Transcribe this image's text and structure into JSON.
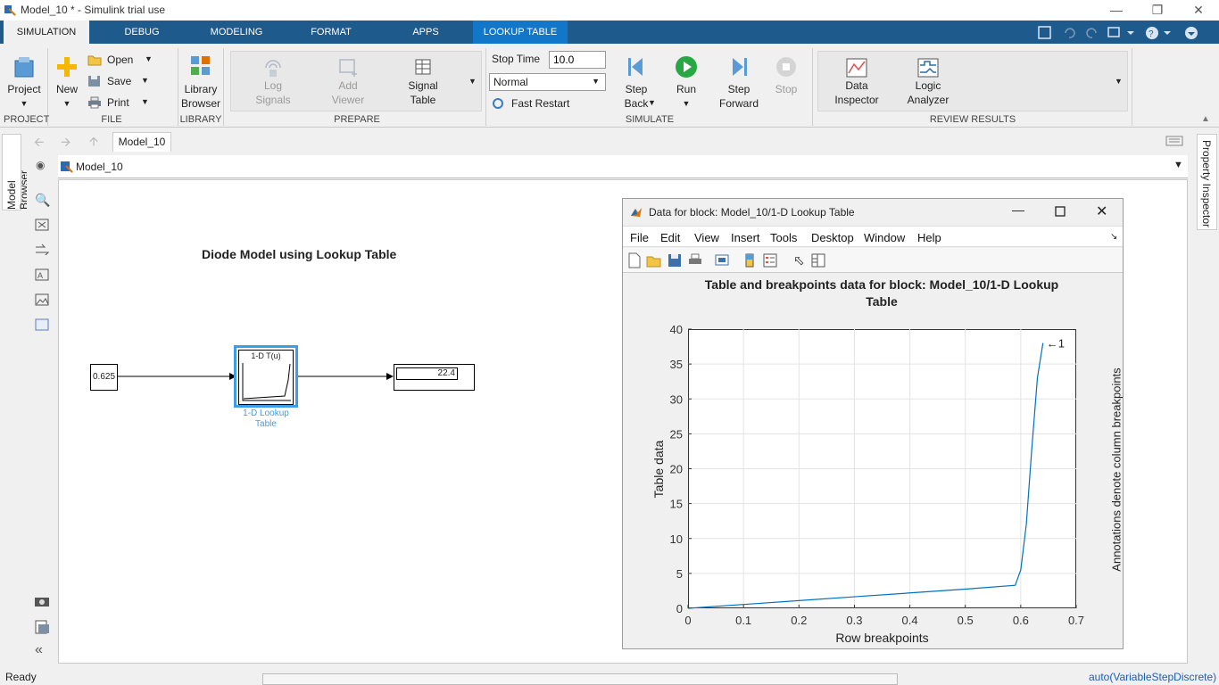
{
  "window": {
    "title": "Model_10 * - Simulink trial use"
  },
  "tabs": [
    "SIMULATION",
    "DEBUG",
    "MODELING",
    "FORMAT",
    "APPS",
    "LOOKUP TABLE"
  ],
  "ribbon": {
    "project": "Project",
    "new": "New",
    "open": "Open",
    "save": "Save",
    "print": "Print",
    "library_browser": [
      "Library",
      "Browser"
    ],
    "log_signals": [
      "Log",
      "Signals"
    ],
    "add_viewer": [
      "Add",
      "Viewer"
    ],
    "signal_table": [
      "Signal",
      "Table"
    ],
    "stop_time_label": "Stop Time",
    "stop_time_value": "10.0",
    "sim_mode": "Normal",
    "fast_restart": "Fast Restart",
    "step_back": [
      "Step",
      "Back"
    ],
    "run": "Run",
    "step_forward": [
      "Step",
      "Forward"
    ],
    "stop": "Stop",
    "data_inspector": [
      "Data",
      "Inspector"
    ],
    "logic_analyzer": [
      "Logic",
      "Analyzer"
    ],
    "sections": {
      "project": "PROJECT",
      "file": "FILE",
      "library": "LIBRARY",
      "prepare": "PREPARE",
      "simulate": "SIMULATE",
      "review": "REVIEW RESULTS"
    }
  },
  "nav": {
    "breadcrumb_tab": "Model_10",
    "address": "Model_10"
  },
  "side": {
    "model_browser": "Model Browser",
    "property_inspector": "Property Inspector"
  },
  "model": {
    "title": "Diode Model using Lookup Table",
    "constant_value": "0.625",
    "lut_header": "1-D T(u)",
    "lut_label": [
      "1-D Lookup",
      "Table"
    ],
    "display_value": "22.4"
  },
  "figure": {
    "title": "Data for block: Model_10/1-D Lookup Table",
    "menus": [
      "File",
      "Edit",
      "View",
      "Insert",
      "Tools",
      "Desktop",
      "Window",
      "Help"
    ],
    "plot_title": [
      "Table and breakpoints data for block: Model_10/1-D Lookup",
      "Table"
    ],
    "annotation": "←1",
    "right_label": "Annotations denote column breakpoints"
  },
  "chart_data": {
    "type": "line",
    "title": "Table and breakpoints data for block: Model_10/1-D Lookup Table",
    "xlabel": "Row breakpoints",
    "ylabel": "Table data",
    "xlim": [
      0,
      0.7
    ],
    "ylim": [
      0,
      40
    ],
    "xticks": [
      "0",
      "0.1",
      "0.2",
      "0.3",
      "0.4",
      "0.5",
      "0.6",
      "0.7"
    ],
    "yticks": [
      "0",
      "5",
      "10",
      "15",
      "20",
      "25",
      "30",
      "35",
      "40"
    ],
    "grid": true,
    "series": [
      {
        "color": "#0072bd",
        "x": [
          0,
          0.1,
          0.2,
          0.3,
          0.4,
          0.5,
          0.59,
          0.6,
          0.61,
          0.62,
          0.63,
          0.64
        ],
        "y": [
          0,
          0.55,
          1.1,
          1.65,
          2.2,
          2.75,
          3.3,
          5.5,
          12,
          23,
          33,
          38
        ]
      }
    ]
  },
  "status": {
    "left": "Ready",
    "right": "auto(VariableStepDiscrete)"
  },
  "colors": {
    "tab_bar": "#1f5a8c",
    "lookup_tab": "#1277c8",
    "selection": "#3a9ee8",
    "plot_line": "#0072bd"
  }
}
